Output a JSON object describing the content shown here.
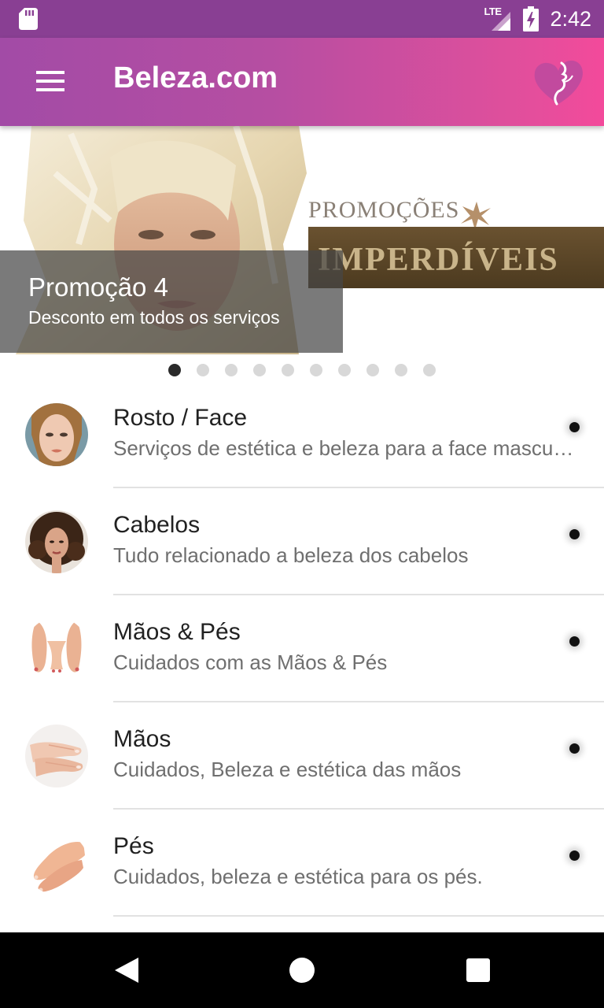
{
  "status_bar": {
    "time": "2:42",
    "network": "LTE",
    "icons": [
      "sd-card-icon",
      "lte-signal-icon",
      "battery-charging-icon"
    ]
  },
  "app_bar": {
    "title": "Beleza.com",
    "menu_icon": "hamburger-menu-icon",
    "logo": "beleza-heart-logo"
  },
  "banner": {
    "promo_title": "Promoção 4",
    "promo_subtitle": "Desconto em todos os serviços",
    "image_text_top": "PROMOÇÕES",
    "image_text_bottom": "IMPERDÍVEIS",
    "total_pages": 10,
    "active_page": 1
  },
  "categories": [
    {
      "title": "Rosto / Face",
      "subtitle": "Serviços de estética e beleza para a face masculina e feminina"
    },
    {
      "title": "Cabelos",
      "subtitle": "Tudo relacionado a beleza dos cabelos"
    },
    {
      "title": "Mãos & Pés",
      "subtitle": "Cuidados com as Mãos & Pés"
    },
    {
      "title": "Mãos",
      "subtitle": "Cuidados, Beleza e estética das mãos"
    },
    {
      "title": "Pés",
      "subtitle": "Cuidados, beleza e estética para os pés."
    }
  ],
  "colors": {
    "status_bar": "#893f93",
    "app_bar_start": "#a24ba6",
    "app_bar_end": "#f34a9b",
    "title_text": "#212121",
    "subtitle_text": "#6f6f6f"
  },
  "nav_bar": {
    "icons": [
      "back-icon",
      "home-icon",
      "recent-apps-icon"
    ]
  }
}
